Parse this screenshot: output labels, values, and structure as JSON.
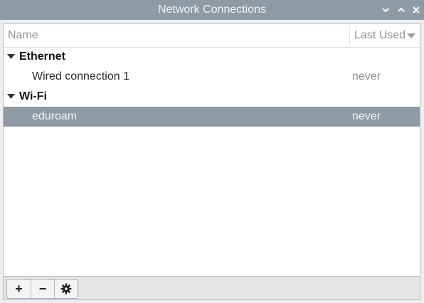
{
  "window": {
    "title": "Network Connections",
    "controls": [
      "chevron-down-icon",
      "chevron-up-icon",
      "close-icon"
    ]
  },
  "list": {
    "columns": {
      "name": "Name",
      "last_used": "Last Used"
    },
    "groups": [
      {
        "label": "Ethernet",
        "connections": [
          {
            "name": "Wired connection 1",
            "last_used": "never",
            "selected": false
          }
        ]
      },
      {
        "label": "Wi-Fi",
        "connections": [
          {
            "name": "eduroam",
            "last_used": "never",
            "selected": true
          }
        ]
      }
    ]
  },
  "toolbar": {
    "add_label": "+",
    "remove_label": "−",
    "settings_icon": "gear-icon"
  },
  "colors": {
    "titlebar": "#8e9aa4",
    "selection": "#8e9aa4",
    "content_bg": "#ffffff"
  }
}
